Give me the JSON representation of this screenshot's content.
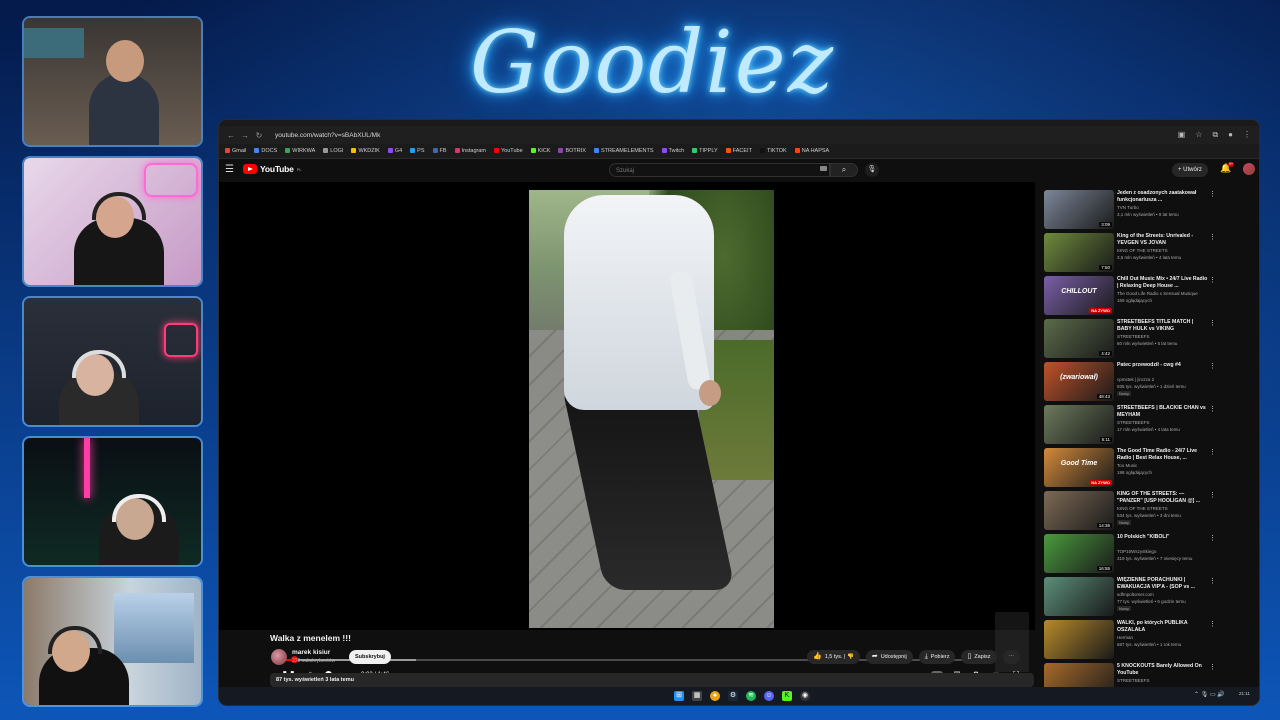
{
  "brand": "Goodiez",
  "colors": {
    "youtube_red": "#ff0000",
    "accent_glow": "#6fd3ff"
  },
  "browser": {
    "url": "youtube.com/watch?v=sBAbXUL/Mk",
    "bookmarks": [
      "Gmail",
      "DOCS",
      "WIRKWA",
      "LOGI",
      "WKDZIK",
      "G4",
      "PS",
      "FB",
      "Instagram",
      "YouTube",
      "KICK",
      "BOTRIX",
      "STREAMELEMENTS",
      "Twitch",
      "TIPPLY",
      "FACEIT",
      "TIKTOK",
      "NA HAPSA"
    ]
  },
  "youtube": {
    "logo_text": "YouTube",
    "logo_country": "PL",
    "search_placeholder": "Szukaj",
    "create_label": "Utwórz",
    "notification_count": "9+"
  },
  "player": {
    "progress": 0.025,
    "buffered": 0.2,
    "time_display": "0:02 / 1:46"
  },
  "video": {
    "title": "Walka z menelem !!!",
    "channel": "marek kisiur",
    "subscribers": "223 subskrybentów",
    "subscribe_label": "Subskrybuj",
    "likes": "1,5 tys.",
    "share_label": "Udostępnij",
    "download_label": "Pobierz",
    "save_label": "Zapisz",
    "description_meta": "87 tys. wyświetleń  3 lata temu"
  },
  "recommendations": [
    {
      "title": "Jeden z osadzonych zaatakował funkcjonariusza ...",
      "channel": "TVN Turbo",
      "meta": "3,1 mln wyświetleń • 9 lat temu",
      "duration": "3:09",
      "thumb_color": "#7c8799"
    },
    {
      "title": "King of the Streets: Unrivaled - YEVGEN VS JOVAN",
      "channel": "KING OF THE STREETS",
      "meta": "3,5 mln wyświetleń • 4 lata temu",
      "duration": "7:50",
      "thumb_color": "#6e8b3d"
    },
    {
      "title": "Chill Out Music Mix • 24/7 Live Radio | Relaxing Deep House ...",
      "channel": "The Good Life Radio x Sensual Musique",
      "meta": "169 oglądających",
      "live": "NA ŻYWO",
      "thumb_text": "CHILLOUT",
      "thumb_color": "#7a5fa8"
    },
    {
      "title": "STREETBEEFS TITLE MATCH | BABY HULK vs VIKING",
      "channel": "STREETBEEFS",
      "meta": "60 mln wyświetleń • 5 lat temu",
      "duration": "4:42",
      "thumb_color": "#5b6b4a"
    },
    {
      "title": "Patec przewodził - cwg #4",
      "channel": "cpmstek | jirozza 2",
      "meta": "935 tys. wyświetleń • 1 dzień temu",
      "badge": "Nowy",
      "duration": "48:43",
      "thumb_text": "(zwariował)",
      "thumb_color": "#c0522a"
    },
    {
      "title": "STREETBEEFS | BLACKIE CHAN vs MEYHAM",
      "channel": "STREETBEEFS",
      "meta": "17 mln wyświetleń • 4 lata temu",
      "duration": "5:11",
      "thumb_color": "#6d7a5c"
    },
    {
      "title": "The Good Time Radio - 24/7 Live Radio | Best Relax House, ...",
      "channel": "Too Music",
      "meta": "198 oglądających",
      "live": "NA ŻYWO",
      "thumb_text": "Good Time",
      "thumb_color": "#d48a3a"
    },
    {
      "title": "KING OF THE STREETS: — \"PANZER\" [USP HOOLIGAN @] ...",
      "channel": "KING OF THE STREETS",
      "meta": "534 tys. wyświetleń • 3 dni temu",
      "badge": "Nowy",
      "duration": "14:36",
      "thumb_color": "#7d6a55"
    },
    {
      "title": "10 Polskich \"KIBOLI\"",
      "channel": "TOP10Wszystkiego",
      "meta": "319 tys. wyświetleń • 7 miesięcy temu",
      "duration": "16:55",
      "thumb_color": "#4a9a3e"
    },
    {
      "title": "WIĘZIENNE PORACHUNKI | EWAKUACJA VIP'A - (SOP vs ...",
      "channel": "sdfmpoltomer.com",
      "meta": "77 tys. wyświetleń • 6 godzin temu",
      "badge": "Nowy",
      "duration": "",
      "thumb_color": "#5c8f7a"
    },
    {
      "title": "WALKI, po których PUBLIKA OSZALAŁA",
      "channel": "Herman",
      "meta": "687 tys. wyświetleń • 1 rok temu",
      "duration": "",
      "thumb_color": "#b88a2a"
    },
    {
      "title": "5 KNOCKOUTS Barely Allowed On YouTube",
      "channel": "STREETBEEFS",
      "meta": "",
      "duration": "",
      "thumb_color": "#a86a2a"
    }
  ]
}
